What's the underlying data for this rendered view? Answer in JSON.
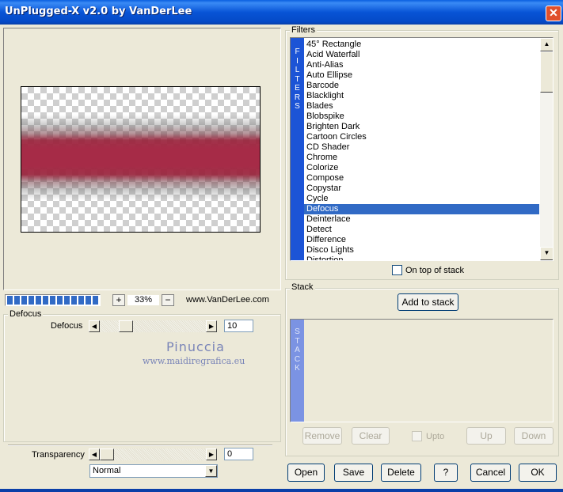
{
  "window": {
    "title": "UnPlugged-X v2.0 by VanDerLee",
    "close_label": "✕"
  },
  "filters": {
    "group_label": "Filters",
    "side_label": "FILTERS",
    "items": [
      "45° Rectangle",
      "Acid Waterfall",
      "Anti-Alias",
      "Auto Ellipse",
      "Barcode",
      "Blacklight",
      "Blades",
      "Blobspike",
      "Brighten Dark",
      "Cartoon Circles",
      "CD Shader",
      "Chrome",
      "Colorize",
      "Compose",
      "Copystar",
      "Cycle",
      "Defocus",
      "Deinterlace",
      "Detect",
      "Difference",
      "Disco Lights",
      "Distortion"
    ],
    "selected": "Defocus",
    "on_top_label": "On top of stack",
    "on_top_checked": false
  },
  "preview": {
    "zoom": "33%",
    "zoom_plus": "+",
    "zoom_minus": "−",
    "website": "www.VanDerLee.com",
    "progress_segments": 13
  },
  "defocus": {
    "group_label": "Defocus",
    "slider_label": "Defocus",
    "value": "10"
  },
  "watermark": {
    "name": "Pinuccia",
    "url": "www.maidiregrafica.eu"
  },
  "transparency": {
    "label": "Transparency",
    "value": "0",
    "blend_mode": "Normal"
  },
  "stack": {
    "group_label": "Stack",
    "side_label": "STACK",
    "add_button": "Add to stack",
    "remove_button": "Remove",
    "clear_button": "Clear",
    "upto_label": "Upto",
    "up_button": "Up",
    "down_button": "Down"
  },
  "buttons": {
    "open": "Open",
    "save": "Save",
    "delete": "Delete",
    "help": "?",
    "cancel": "Cancel",
    "ok": "OK"
  }
}
